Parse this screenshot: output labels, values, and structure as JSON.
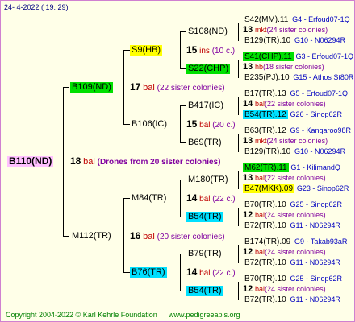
{
  "header": {
    "date": "24-  4-2022 ( 19: 29)"
  },
  "footer": {
    "copyright": "Copyright 2004-2022 © Karl Kehrle Foundation",
    "site": "www.pedigreeapis.org"
  },
  "root": {
    "id": "B110(ND)",
    "count": "18",
    "bal": "bal",
    "note": "(Drones from 20 sister colonies)",
    "highlight": "#ffc0ff"
  },
  "gen1": [
    {
      "id": "B109(ND)",
      "count": "17",
      "bal": "bal",
      "note": "(22 sister colonies)",
      "highlight": "#00e000"
    },
    {
      "id": "M112(TR)",
      "count": "16",
      "bal": "bal",
      "note": "(20 sister colonies)",
      "highlight": ""
    }
  ],
  "gen2": [
    {
      "id": "S9(HB)",
      "count": "15",
      "bal": "ins",
      "note": "(10 c.)",
      "highlight": "#ffff00"
    },
    {
      "id": "B106(IC)",
      "count": "15",
      "bal": "bal",
      "note": "(20 c.)",
      "highlight": ""
    },
    {
      "id": "M84(TR)",
      "count": "14",
      "bal": "bal",
      "note": "(22 c.)",
      "highlight": ""
    },
    {
      "id": "B76(TR)",
      "count": "14",
      "bal": "bal",
      "note": "(22 c.)",
      "highlight": "#00e0ff"
    }
  ],
  "gen3": [
    {
      "id": "S108(ND)",
      "highlight": "",
      "children": [
        {
          "text": "S42(MM).11",
          "code": "G4 - Erfoud07-1Q",
          "highlight": ""
        },
        {
          "count": "13",
          "bal": "mkt",
          "note": "(24 sister colonies)"
        },
        {
          "text": "B129(TR).10",
          "code": "G10 - N06294R",
          "highlight": ""
        }
      ]
    },
    {
      "id": "S22(CHP)",
      "highlight": "#00e000",
      "children": [
        {
          "text": "S41(CHP).11",
          "code": "G3 - Erfoud07-1Q",
          "highlight": "#00e000"
        },
        {
          "count": "13",
          "bal": "hb",
          "note": "(18 sister colonies)"
        },
        {
          "text": "B235(PJ).10",
          "code": "G15 - Athos St80R",
          "highlight": ""
        }
      ]
    },
    {
      "id": "B417(IC)",
      "highlight": "",
      "children": [
        {
          "text": "B17(TR).13",
          "code": "G5 - Erfoud07-1Q",
          "highlight": ""
        },
        {
          "count": "14",
          "bal": "bal",
          "note": "(22 sister colonies)"
        },
        {
          "text": "B54(TR).12",
          "code": "G26 - Sinop62R",
          "highlight": "#00e0ff"
        }
      ]
    },
    {
      "id": "B69(TR)",
      "highlight": "",
      "children": [
        {
          "text": "B63(TR).12",
          "code": "G9 - Kangaroo98R",
          "highlight": ""
        },
        {
          "count": "13",
          "bal": "mkt",
          "note": "(24 sister colonies)"
        },
        {
          "text": "B129(TR).10",
          "code": "G10 - N06294R",
          "highlight": ""
        }
      ]
    },
    {
      "id": "M180(TR)",
      "highlight": "",
      "children": [
        {
          "text": "M62(TR).11",
          "code": "G1 - KilimandQ",
          "highlight": "#00e000"
        },
        {
          "count": "13",
          "bal": "bal",
          "note": "(22 sister colonies)"
        },
        {
          "text": "B47(MKK).09",
          "code": "G23 - Sinop62R",
          "highlight": "#ffff00"
        }
      ]
    },
    {
      "id": "B54(TR)",
      "highlight": "#00e0ff",
      "children": [
        {
          "text": "B70(TR).10",
          "code": "G25 - Sinop62R",
          "highlight": ""
        },
        {
          "count": "12",
          "bal": "bal",
          "note": "(24 sister colonies)"
        },
        {
          "text": "B72(TR).10",
          "code": "G11 - N06294R",
          "highlight": ""
        }
      ]
    },
    {
      "id": "B79(TR)",
      "highlight": "",
      "children": [
        {
          "text": "B174(TR).09",
          "code": "G9 - Takab93aR",
          "highlight": ""
        },
        {
          "count": "12",
          "bal": "bal",
          "note": "(24 sister colonies)"
        },
        {
          "text": "B72(TR).10",
          "code": "G11 - N06294R",
          "highlight": ""
        }
      ]
    },
    {
      "id": "B54(TR)",
      "highlight": "#00e0ff",
      "children": [
        {
          "text": "B70(TR).10",
          "code": "G25 - Sinop62R",
          "highlight": ""
        },
        {
          "count": "12",
          "bal": "bal",
          "note": "(24 sister colonies)"
        },
        {
          "text": "B72(TR).10",
          "code": "G11 - N06294R",
          "highlight": ""
        }
      ]
    }
  ]
}
